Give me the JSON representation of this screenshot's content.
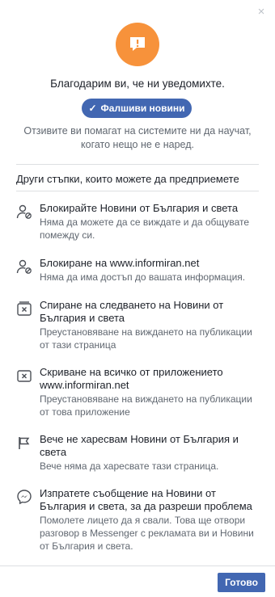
{
  "dialog": {
    "close_symbol": "×",
    "thanks": "Благодарим ви, че ни уведомихте.",
    "tag_label": "Фалшиви новини",
    "description": "Отзивите ви помагат на системите ни да научат, когато нещо не е наред.",
    "section_title": "Други стъпки, които можете да предприемете",
    "done_label": "Готово"
  },
  "actions": [
    {
      "icon": "block-person-icon",
      "title": "Блокирайте Новини от България и света",
      "subtitle": "Няма да можете да се виждате и да общувате помежду си."
    },
    {
      "icon": "block-person-icon",
      "title": "Блокиране на www.informiran.net",
      "subtitle": "Няма да има достъп до вашата информация."
    },
    {
      "icon": "unfollow-icon",
      "title": "Спиране на следването на Новини от България и света",
      "subtitle": "Преустановяване на виждането на публикации от тази страница"
    },
    {
      "icon": "hide-app-icon",
      "title": "Скриване на всичко от приложението www.informiran.net",
      "subtitle": "Преустановяване на виждането на публикации от това приложение"
    },
    {
      "icon": "flag-icon",
      "title": "Вече не харесвам Новини от България и света",
      "subtitle": "Вече няма да харесвате тази страница."
    },
    {
      "icon": "messenger-icon",
      "title": "Изпратете съобщение на Новини от България и света, за да разреши проблема",
      "subtitle": "Помолете лицето да я свали. Това ще отвори разговор в Messenger с рекламата ви и Новини от България и света."
    }
  ],
  "colors": {
    "accent": "#4267b2",
    "alert": "#f7923b",
    "secondary_text": "#606770"
  }
}
